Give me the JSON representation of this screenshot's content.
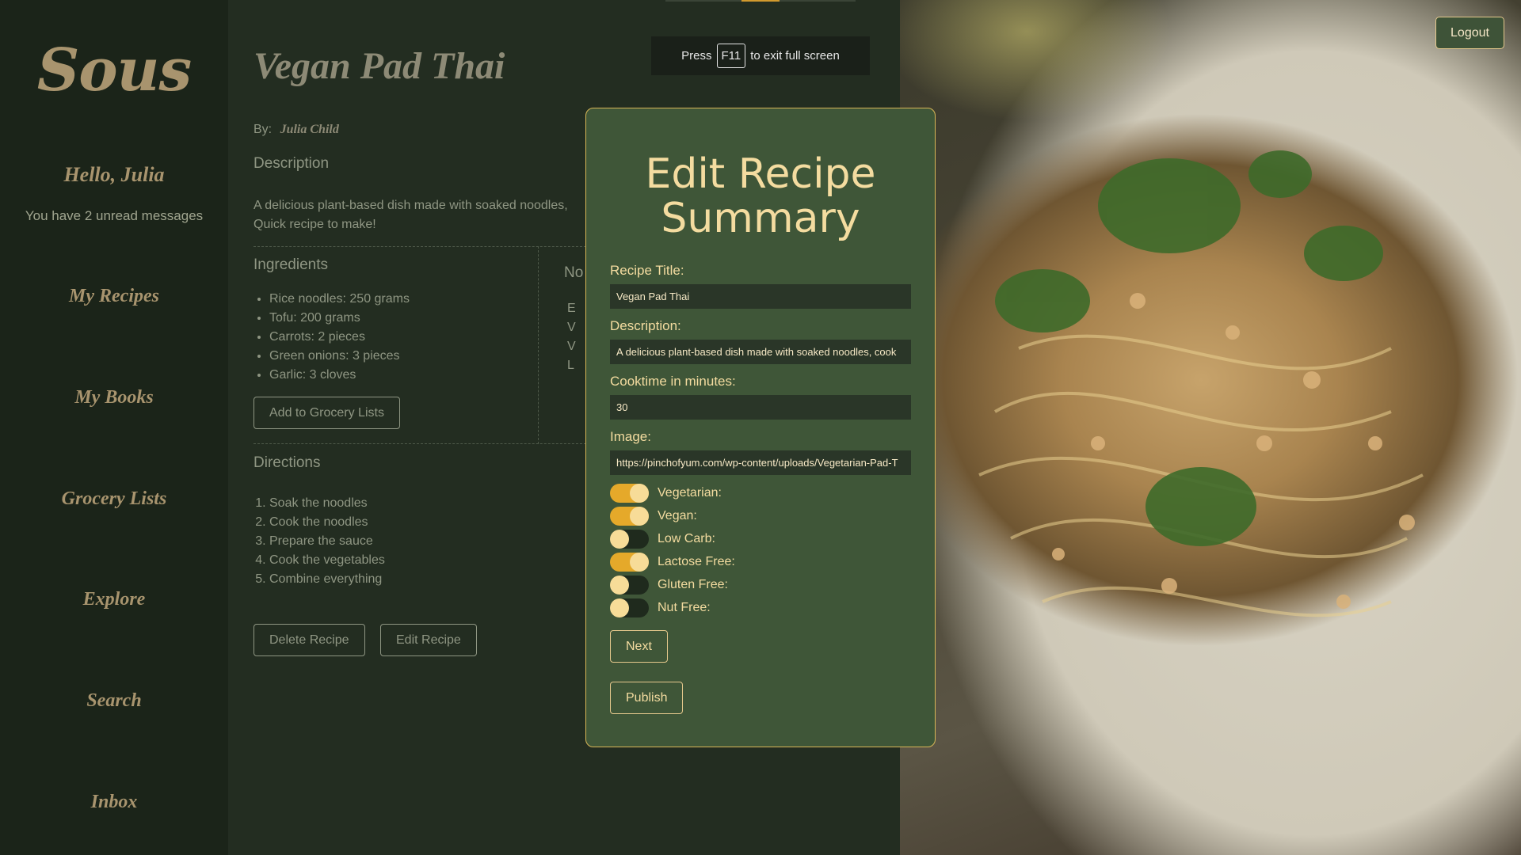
{
  "app": {
    "logo": "Sous"
  },
  "sidebar": {
    "greeting": "Hello, Julia",
    "unread": "You have 2 unread messages",
    "nav": [
      "My Recipes",
      "My Books",
      "Grocery Lists",
      "Explore",
      "Search",
      "Inbox"
    ]
  },
  "recipe": {
    "title": "Vegan Pad Thai",
    "by_label": "By:",
    "author": "Julia Child",
    "description_heading": "Description",
    "description_line1": "A delicious plant-based dish made with soaked noodles,",
    "description_line2": "Quick recipe to make!",
    "ingredients_heading": "Ingredients",
    "ingredients": [
      "Rice noodles: 250 grams",
      "Tofu: 200 grams",
      "Carrots: 2 pieces",
      "Green onions: 3 pieces",
      "Garlic: 3 cloves"
    ],
    "notes_heading": "No",
    "notes": [
      "E",
      "V",
      "V",
      "L"
    ],
    "add_grocery_label": "Add to Grocery Lists",
    "directions_heading": "Directions",
    "directions": [
      "Soak the noodles",
      "Cook the noodles",
      "Prepare the sauce",
      "Cook the vegetables",
      "Combine everything"
    ],
    "delete_label": "Delete Recipe",
    "edit_label": "Edit Recipe"
  },
  "fullscreen": {
    "press": "Press",
    "key": "F11",
    "rest": "to exit full screen"
  },
  "header": {
    "logout_label": "Logout"
  },
  "modal": {
    "title_line1": "Edit Recipe",
    "title_line2": "Summary",
    "title_label": "Recipe Title:",
    "title_value": "Vegan Pad Thai",
    "description_label": "Description:",
    "description_value": "A delicious plant-based dish made with soaked noodles, cook",
    "cooktime_label": "Cooktime in minutes:",
    "cooktime_value": "30",
    "image_label": "Image:",
    "image_value": "https://pinchofyum.com/wp-content/uploads/Vegetarian-Pad-T",
    "toggles": [
      {
        "label": "Vegetarian:",
        "on": true
      },
      {
        "label": "Vegan:",
        "on": true
      },
      {
        "label": "Low Carb:",
        "on": false
      },
      {
        "label": "Lactose Free:",
        "on": true
      },
      {
        "label": "Gluten Free:",
        "on": false
      },
      {
        "label": "Nut Free:",
        "on": false
      }
    ],
    "next_label": "Next",
    "publish_label": "Publish"
  },
  "colors": {
    "accent": "#e5a92a",
    "modal_bg": "#3f5638",
    "sidebar_bg": "#1b2419",
    "gold_text": "#a8946e"
  }
}
